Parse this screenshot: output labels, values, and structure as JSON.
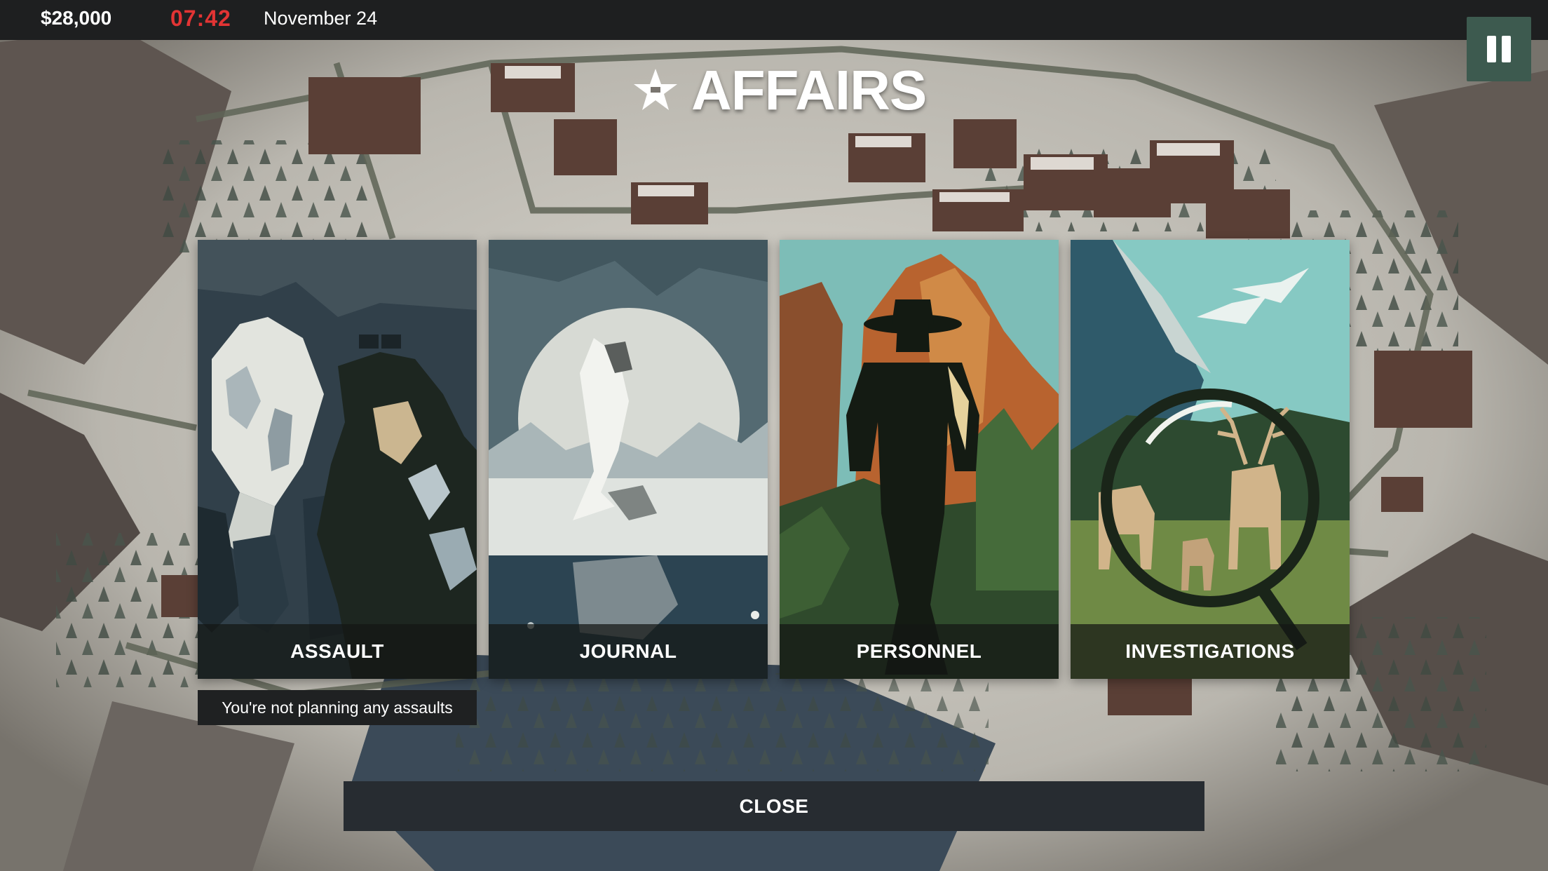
{
  "status_bar": {
    "money": "$28,000",
    "time": "07:42",
    "date": "November 24",
    "pause_icon": "pause-icon"
  },
  "screen": {
    "title": "AFFAIRS",
    "title_icon": "star-badge-icon"
  },
  "cards": [
    {
      "label": "ASSAULT",
      "note": "You're not planning any assaults"
    },
    {
      "label": "JOURNAL"
    },
    {
      "label": "PERSONNEL"
    },
    {
      "label": "INVESTIGATIONS"
    }
  ],
  "close_button": {
    "label": "CLOSE"
  },
  "colors": {
    "topbar": "#1e1f20",
    "time": "#e23434",
    "pause_button": "#3d5a4f",
    "close_button": "#272c31"
  }
}
